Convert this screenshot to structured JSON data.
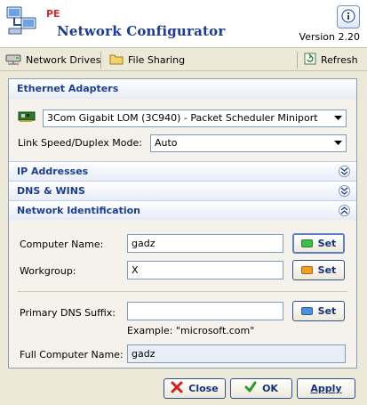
{
  "header": {
    "pe_label": "PE",
    "title": "Network Configurator",
    "version": "Version 2.20"
  },
  "toolbar": {
    "network_drives": "Network Drives",
    "file_sharing": "File Sharing",
    "refresh": "Refresh"
  },
  "sections": {
    "ethernet": {
      "title": "Ethernet Adapters",
      "adapter": "3Com Gigabit LOM (3C940) - Packet Scheduler Miniport",
      "link_label": "Link Speed/Duplex Mode:",
      "link_value": "Auto"
    },
    "ip": {
      "title": "IP Addresses"
    },
    "dns": {
      "title": "DNS & WINS"
    },
    "netid": {
      "title": "Network Identification",
      "computer_name_label": "Computer Name:",
      "computer_name": "gadz",
      "workgroup_label": "Workgroup:",
      "workgroup": "X",
      "dns_suffix_label": "Primary DNS Suffix:",
      "dns_suffix": "",
      "example": "Example: \"microsoft.com\"",
      "full_name_label": "Full Computer Name:",
      "full_name": "gadz",
      "set_label": "Set"
    }
  },
  "buttons": {
    "close": "Close",
    "ok": "OK",
    "apply": "Apply"
  },
  "colors": {
    "title_blue": "#1b3a9a",
    "section_blue": "#1c3f94",
    "led_green": "#3cc04a",
    "led_orange": "#f0a020",
    "led_blue": "#4a8fe0",
    "close_red": "#d02020",
    "ok_green": "#2a9a2a"
  },
  "icons": [
    "app-network-icon",
    "info-icon",
    "network-drive-icon",
    "file-sharing-icon",
    "refresh-icon",
    "network-card-icon",
    "chevron-down-icon",
    "chevron-up-icon",
    "close-x-icon",
    "ok-check-icon"
  ]
}
